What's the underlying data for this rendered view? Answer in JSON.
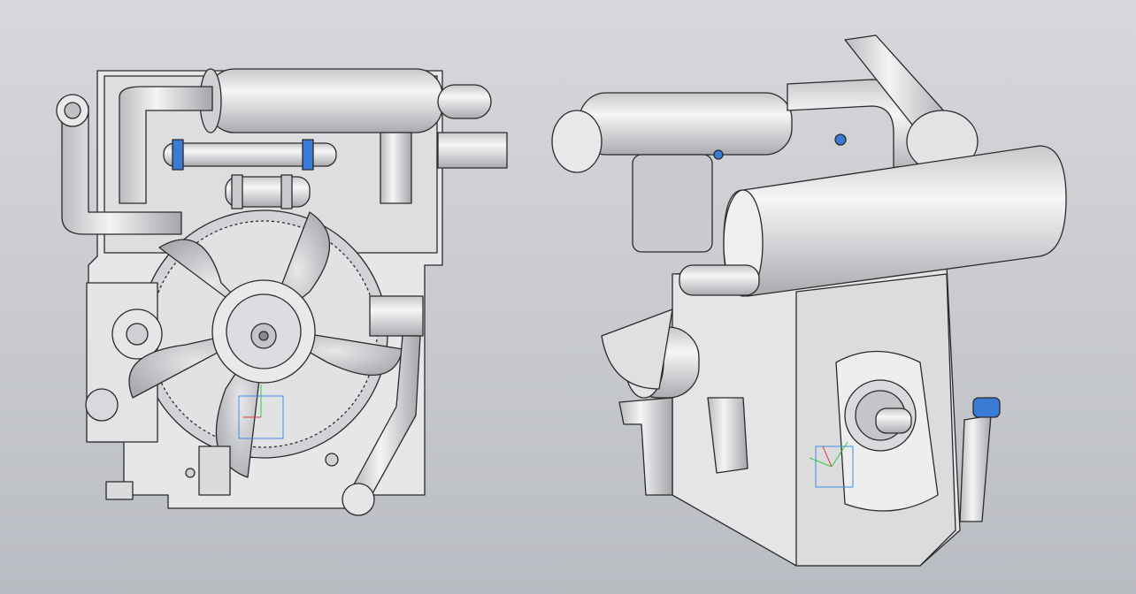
{
  "scene": {
    "background_top": "#d6d8dc",
    "background_bottom": "#b9bcc2",
    "part_fill": "#e4e4e6",
    "part_dark": "#9a9ca1",
    "outline": "#2a2a2a",
    "clamp_color": "#3a7bd5",
    "views": [
      {
        "name": "front-view",
        "icon": "engine-front-view"
      },
      {
        "name": "iso-view",
        "icon": "engine-isometric-view"
      }
    ],
    "triad_colors": {
      "x": "#e23b3b",
      "y": "#2ecc40",
      "z": "#2f7fe8",
      "frame": "#3a8fe0"
    }
  }
}
